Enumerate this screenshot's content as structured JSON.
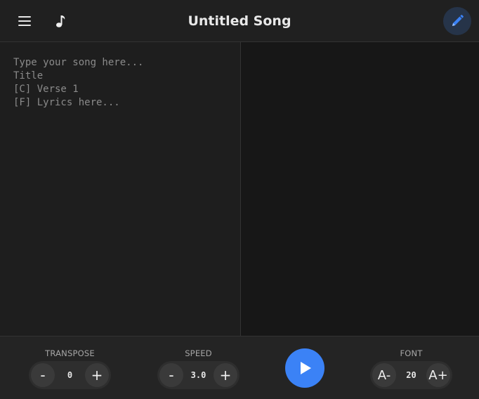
{
  "header": {
    "title": "Untitled Song",
    "menu_icon": "hamburger-menu-icon",
    "note_icon": "music-note-icon",
    "edit_icon": "pencil-icon",
    "accent": "#3b82f6"
  },
  "editor": {
    "value": "",
    "placeholder": "Type your song here...\nTitle\n[C] Verse 1\n[F] Lyrics here..."
  },
  "controls": {
    "transpose": {
      "label": "TRANSPOSE",
      "minus": "-",
      "plus": "+",
      "value": "0"
    },
    "speed": {
      "label": "SPEED",
      "minus": "-",
      "plus": "+",
      "value": "3.0"
    },
    "play_icon": "play-icon",
    "font": {
      "label": "FONT",
      "minus": "A-",
      "plus": "A+",
      "value": "20"
    }
  }
}
